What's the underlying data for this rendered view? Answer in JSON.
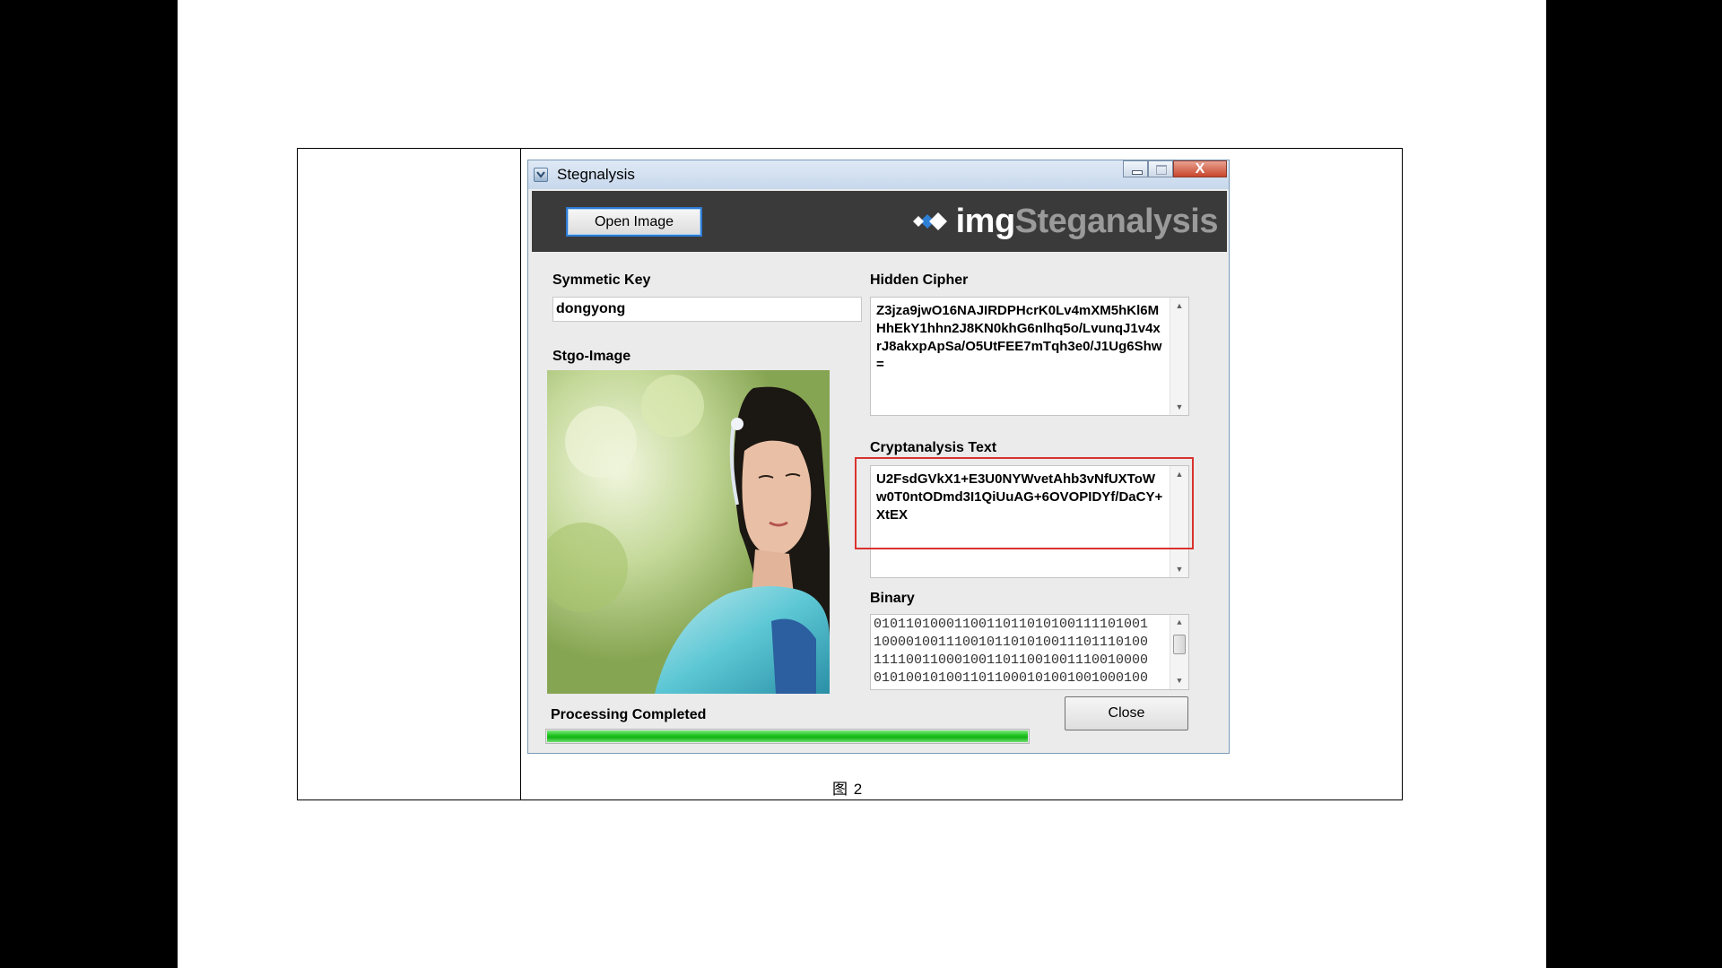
{
  "window": {
    "title": "Stegnalysis",
    "controls": [
      "minimize-icon",
      "maximize-icon",
      "close-icon"
    ],
    "close_glyph": "X"
  },
  "header": {
    "open_button": "Open Image",
    "logo_prefix": "img",
    "logo_suffix": "Steganalysis",
    "logo_icon": "diamond-logo-icon"
  },
  "left": {
    "key_label": "Symmetic Key",
    "key_value": "dongyong",
    "image_label": "Stgo-Image"
  },
  "right": {
    "cipher_label": "Hidden Cipher",
    "cipher_text": "Z3jza9jwO16NAJIRDPHcrK0Lv4mXM5hKl6MHhEkY1hhn2J8KN0khG6nlhq5o/LvunqJ1v4xrJ8akxpApSa/O5UtFEE7mTqh3e0/J1Ug6Shw=",
    "crypt_label": "Cryptanalysis  Text",
    "crypt_text": "U2FsdGVkX1+E3U0NYWvetAhb3vNfUXToWw0T0ntODmd3I1QiUuAG+6OVOPIDYf/DaCY+XtEX",
    "binary_label": "Binary",
    "binary_lines": [
      "0101101000110011011010100111101001",
      "1000010011100101101010011101110100",
      "1111001100010011011001001110010000",
      "0101001010011011000101001001000100"
    ]
  },
  "footer": {
    "status": "Processing Completed",
    "progress_fraction": 1.0,
    "close_button": "Close"
  },
  "caption": "图 2",
  "colors": {
    "header_bg": "#3a3a3a",
    "logo_accent": "#9a9a9a",
    "progress": "#1cc21c",
    "highlight": "#d9332f"
  }
}
